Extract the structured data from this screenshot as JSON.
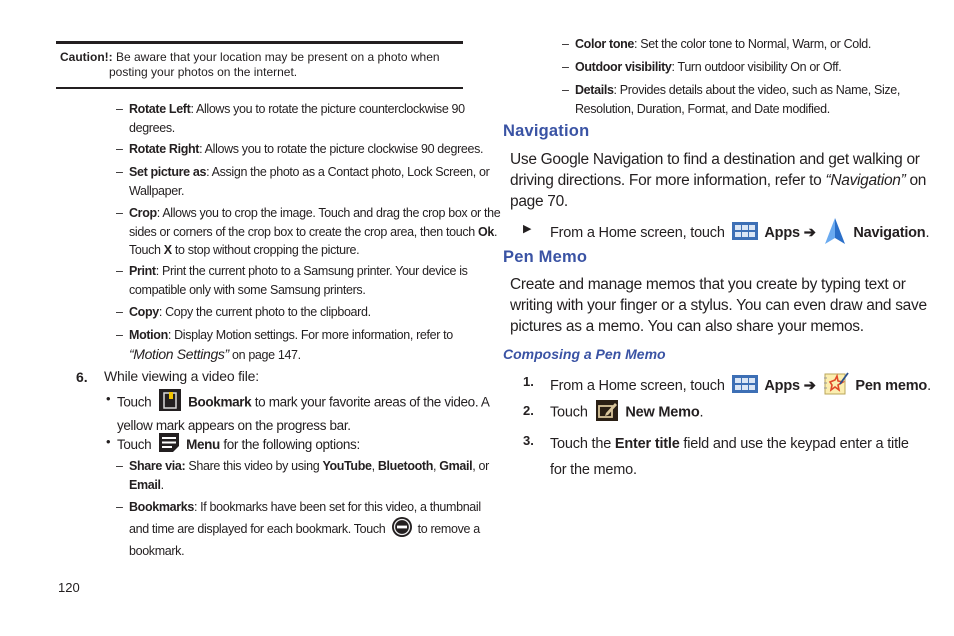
{
  "caution": {
    "label": "Caution!:",
    "line1": "Be aware that your location may be present on a photo when",
    "line2": "posting your photos on the internet."
  },
  "left_column": {
    "photo_options": [
      {
        "term": "Rotate Left",
        "text1": ": Allows you to rotate the picture counterclockwise 90",
        "text2": "degrees."
      },
      {
        "term": "Rotate Right",
        "text1": ": Allows you to rotate the picture clockwise 90 degrees."
      },
      {
        "term": "Set picture as",
        "text1": ": Assign the photo as a Contact photo, Lock Screen, or",
        "text2": "Wallpaper."
      },
      {
        "term": "Crop",
        "text1": ": Allows you to crop the image. Touch and drag the crop box or the",
        "text2a": "sides or corners of the crop box to create the crop area, then touch ",
        "text2b": "Ok",
        "text2c": ".",
        "text3a": "Touch ",
        "text3b": "X",
        "text3c": " to stop without cropping the picture."
      },
      {
        "term": "Print",
        "text1": ": Print the current photo to a Samsung printer. Your device is",
        "text2": "compatible only with some Samsung printers."
      },
      {
        "term": "Copy",
        "text1": ": Copy the current photo to the clipboard."
      },
      {
        "term": "Motion",
        "text1": ": Display Motion settings. For more information, refer to",
        "text2_ref": "“Motion Settings”",
        "text2_tail": "  on page 147."
      }
    ],
    "step6": {
      "number": "6.",
      "text": "While viewing a video file:",
      "bookmark_bullet": {
        "pre": "Touch",
        "term": "Bookmark",
        "post": " to mark your favorite areas of the video. A",
        "line2": "yellow mark appears on the progress bar."
      },
      "menu_bullet": {
        "pre": "Touch",
        "term": "Menu",
        "post": " for the following options:"
      },
      "share_via": {
        "term": "Share via:",
        "text": " Share this video by using ",
        "opt1": "YouTube",
        "sep1": ", ",
        "opt2": "Bluetooth",
        "sep2": ", ",
        "opt3": "Gmail",
        "sep3": ", or",
        "opt4": "Email",
        "end": "."
      },
      "bookmarks": {
        "term": "Bookmarks",
        "text1": ": If bookmarks have been set for this video, a thumbnail",
        "text2a": "and time are displayed for each bookmark. Touch ",
        "text2b": " to remove a",
        "text3": "bookmark."
      }
    }
  },
  "right_column": {
    "video_options": [
      {
        "term": "Color tone",
        "text": ": Set the color tone to Normal, Warm, or Cold."
      },
      {
        "term": "Outdoor visibility",
        "text": ": Turn outdoor visibility On or Off."
      },
      {
        "term": "Details",
        "text1": ": Provides details about the video, such as Name, Size,",
        "text2": "Resolution, Duration, Format, and Date modified."
      }
    ],
    "navigation": {
      "heading": "Navigation",
      "line1": "Use Google Navigation to find a destination and get walking or",
      "line2a": "driving directions. For more information, refer to ",
      "line2_ref": "“Navigation”",
      "line2b": "  on",
      "line3": "page 70.",
      "step": {
        "pre": "From a Home screen, touch",
        "apps": "Apps",
        "arrow": "➔",
        "target": "Navigation",
        "end": "."
      }
    },
    "pen_memo": {
      "heading": "Pen Memo",
      "line1": "Create and manage memos that you create by typing text or",
      "line2": "writing with your finger or a stylus. You can even draw and save",
      "line3": "pictures as a memo. You can also share your memos.",
      "subheading": "Composing a Pen Memo",
      "steps": [
        {
          "number": "1.",
          "pre": "From a Home screen, touch",
          "apps": "Apps",
          "arrow": "➔",
          "target": "Pen memo",
          "end": "."
        },
        {
          "number": "2.",
          "pre": "Touch",
          "target": "New Memo",
          "end": "."
        },
        {
          "number": "3.",
          "pre": "Touch the ",
          "target": "Enter title",
          "post": " field and use the keypad enter a title",
          "line2": "for the memo."
        }
      ]
    }
  },
  "footer": {
    "page_number": "120"
  },
  "colors": {
    "heading_blue": "#3a53a4",
    "text": "#231f20",
    "apps_icon_blue": "#3d6fb5"
  }
}
